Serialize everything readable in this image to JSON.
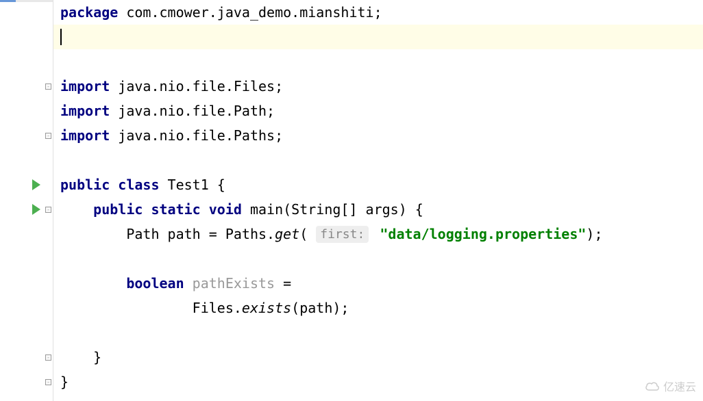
{
  "code": {
    "line1": {
      "kw1": "package",
      "rest": " com.cmower.java_demo.mianshiti;"
    },
    "line3_blank": "",
    "line4": {
      "kw1": "import",
      "rest": " java.nio.file.Files;"
    },
    "line5": {
      "kw1": "import",
      "rest": " java.nio.file.Path;"
    },
    "line6": {
      "kw1": "import",
      "rest": " java.nio.file.Paths;"
    },
    "line8": {
      "kw1": "public class",
      "classname": " Test1 {"
    },
    "line9": {
      "indent": "    ",
      "kw1": "public static void",
      "method": " main(String[] args) {"
    },
    "line10": {
      "indent": "        ",
      "type": "Path path = Paths.",
      "method_italic": "get",
      "open": "( ",
      "hint": "first:",
      "space": " ",
      "str": "\"data/logging.properties\"",
      "close": ");"
    },
    "line12": {
      "indent": "        ",
      "kw1": "boolean",
      "gray": " pathExists",
      "rest": " ="
    },
    "line13": {
      "indent": "                ",
      "cls": "Files.",
      "method_italic": "exists",
      "rest": "(path);"
    },
    "line15": {
      "indent": "    ",
      "brace": "}"
    },
    "line16": {
      "brace": "}"
    }
  },
  "watermark": "亿速云"
}
